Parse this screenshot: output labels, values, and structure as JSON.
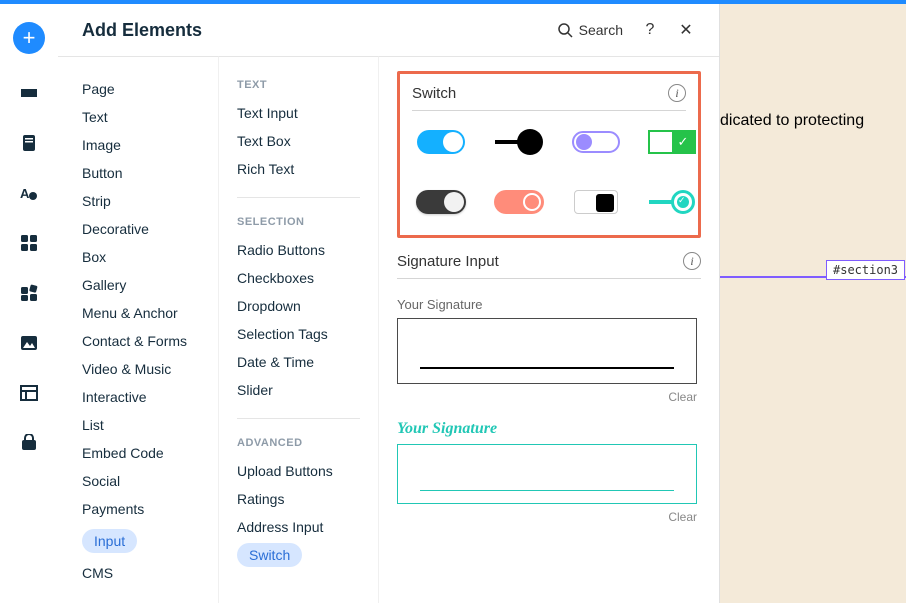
{
  "canvas": {
    "visible_text": "dicated to protecting",
    "section_label": "#section3"
  },
  "panel": {
    "title": "Add Elements",
    "search_label": "Search",
    "help_label": "?",
    "close_label": "✕"
  },
  "col1": {
    "items": [
      {
        "label": "Page"
      },
      {
        "label": "Text"
      },
      {
        "label": "Image"
      },
      {
        "label": "Button"
      },
      {
        "label": "Strip"
      },
      {
        "label": "Decorative"
      },
      {
        "label": "Box"
      },
      {
        "label": "Gallery"
      },
      {
        "label": "Menu & Anchor"
      },
      {
        "label": "Contact & Forms"
      },
      {
        "label": "Video & Music"
      },
      {
        "label": "Interactive"
      },
      {
        "label": "List"
      },
      {
        "label": "Embed Code"
      },
      {
        "label": "Social"
      },
      {
        "label": "Payments"
      },
      {
        "label": "Input",
        "active": true
      },
      {
        "label": "CMS"
      }
    ]
  },
  "col2": {
    "groups": [
      {
        "heading": "TEXT",
        "items": [
          {
            "label": "Text Input"
          },
          {
            "label": "Text Box"
          },
          {
            "label": "Rich Text"
          }
        ]
      },
      {
        "heading": "SELECTION",
        "items": [
          {
            "label": "Radio Buttons"
          },
          {
            "label": "Checkboxes"
          },
          {
            "label": "Dropdown"
          },
          {
            "label": "Selection Tags"
          },
          {
            "label": "Date & Time"
          },
          {
            "label": "Slider"
          }
        ]
      },
      {
        "heading": "ADVANCED",
        "items": [
          {
            "label": "Upload Buttons"
          },
          {
            "label": "Ratings"
          },
          {
            "label": "Address Input"
          },
          {
            "label": "Switch",
            "active": true
          }
        ]
      }
    ]
  },
  "col3": {
    "switch_heading": "Switch",
    "info": "i",
    "signature_heading": "Signature Input",
    "sig_items": [
      {
        "label": "Your Signature",
        "clear": "Clear"
      },
      {
        "label": "Your Signature",
        "clear": "Clear"
      }
    ]
  },
  "rail": {
    "icons": [
      "plus",
      "section",
      "page",
      "typography",
      "grid",
      "widgets",
      "image",
      "table",
      "store"
    ]
  }
}
